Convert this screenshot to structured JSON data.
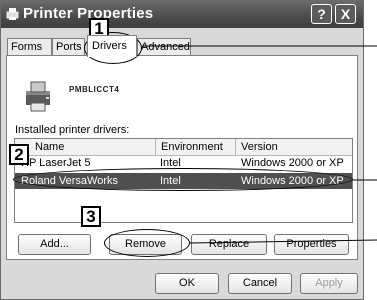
{
  "window": {
    "title": "Printer Properties",
    "help_label": "?",
    "close_label": "X"
  },
  "tabs": [
    {
      "label": "Forms"
    },
    {
      "label": "Ports"
    },
    {
      "label": "Drivers"
    },
    {
      "label": "Advanced"
    }
  ],
  "printer": {
    "name": "PMBLICCT4"
  },
  "drivers": {
    "list_label": "Installed printer drivers:",
    "columns": [
      "Name",
      "Environment",
      "Version"
    ],
    "rows": [
      {
        "name": "HP LaserJet 5",
        "environment": "Intel",
        "version": "Windows 2000 or XP"
      },
      {
        "name": "Roland VersaWorks",
        "environment": "Intel",
        "version": "Windows 2000 or XP"
      }
    ]
  },
  "buttons": {
    "add": "Add...",
    "remove": "Remove",
    "replace": "Replace",
    "properties": "Properties",
    "ok": "OK",
    "cancel": "Cancel",
    "apply": "Apply"
  },
  "callouts": [
    "1",
    "2",
    "3"
  ],
  "icons": {
    "title": "printer-icon",
    "printer": "printer-icon"
  }
}
